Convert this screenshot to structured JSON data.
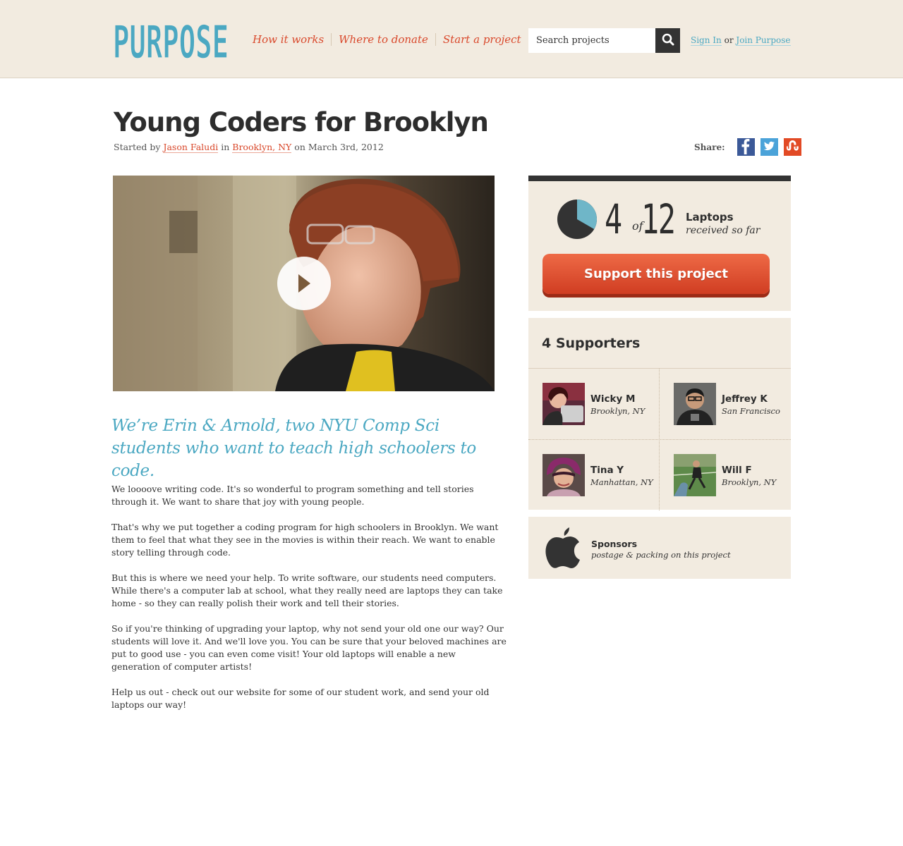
{
  "header": {
    "logo_text": "PURPOSE",
    "nav": [
      "How it works",
      "Where to donate",
      "Start a project"
    ],
    "search": {
      "placeholder": "Search projects",
      "icon": "search-icon"
    },
    "auth": {
      "sign_in": "Sign In",
      "or": "or",
      "join": "Join Purpose"
    }
  },
  "project": {
    "title": "Young Coders for Brooklyn",
    "byline": {
      "started_by": "Started by",
      "author": "Jason Faludi",
      "in": "in",
      "location": "Brooklyn, NY",
      "date": "on March 3rd, 2012"
    },
    "share": {
      "label": "Share:",
      "buttons": [
        "facebook-icon",
        "twitter-icon",
        "stumbleupon-icon"
      ]
    },
    "video": {
      "play_icon": "play-icon"
    },
    "intro": "We’re Erin & Arnold, two NYU Comp Sci students who want to teach  high schoolers to code.",
    "paragraphs": [
      "We loooove writing code.  It's so wonderful to program something and tell stories through it.  We want to share that joy with young people.",
      "That's why we put together a coding program for high schoolers in Brooklyn.  We want them to feel that what they see in the movies is within their reach.  We want to enable story telling through code.",
      "But this is where we need your help.  To write software, our students need computers.  While there's a computer lab at school, what they really need are laptops they can take home - so they can really polish their work and tell their stories.",
      "So if you're thinking of upgrading your laptop, why not send your old one our way?  Our students will love it.  And we'll love you.  You can be sure that your beloved machines are put to good use - you can even come visit!  Your old laptops will enable a new generation of computer artists!",
      "Help us out - check out our website for some of our student work, and send your old laptops our way!"
    ]
  },
  "progress": {
    "received": "4",
    "of": "of",
    "goal": "12",
    "fraction": 0.3333,
    "unit": "Laptops",
    "sub": "received so far",
    "button": "Support this project"
  },
  "supporters": {
    "title": "4 Supporters",
    "list": [
      {
        "name": "Wicky M",
        "location": "Brooklyn, NY"
      },
      {
        "name": "Jeffrey K",
        "location": "San Francisco"
      },
      {
        "name": "Tina Y",
        "location": "Manhattan, NY"
      },
      {
        "name": "Will F",
        "location": "Brooklyn, NY"
      }
    ]
  },
  "sponsors": {
    "icon": "apple-logo-icon",
    "title": "Sponsors",
    "sub": "postage & packing on this project"
  },
  "colors": {
    "accent_red": "#d9482b",
    "accent_blue": "#4ba8c2",
    "header_bg": "#f2ebe0",
    "panel_bg": "#f2ebe0",
    "dark": "#333333"
  }
}
